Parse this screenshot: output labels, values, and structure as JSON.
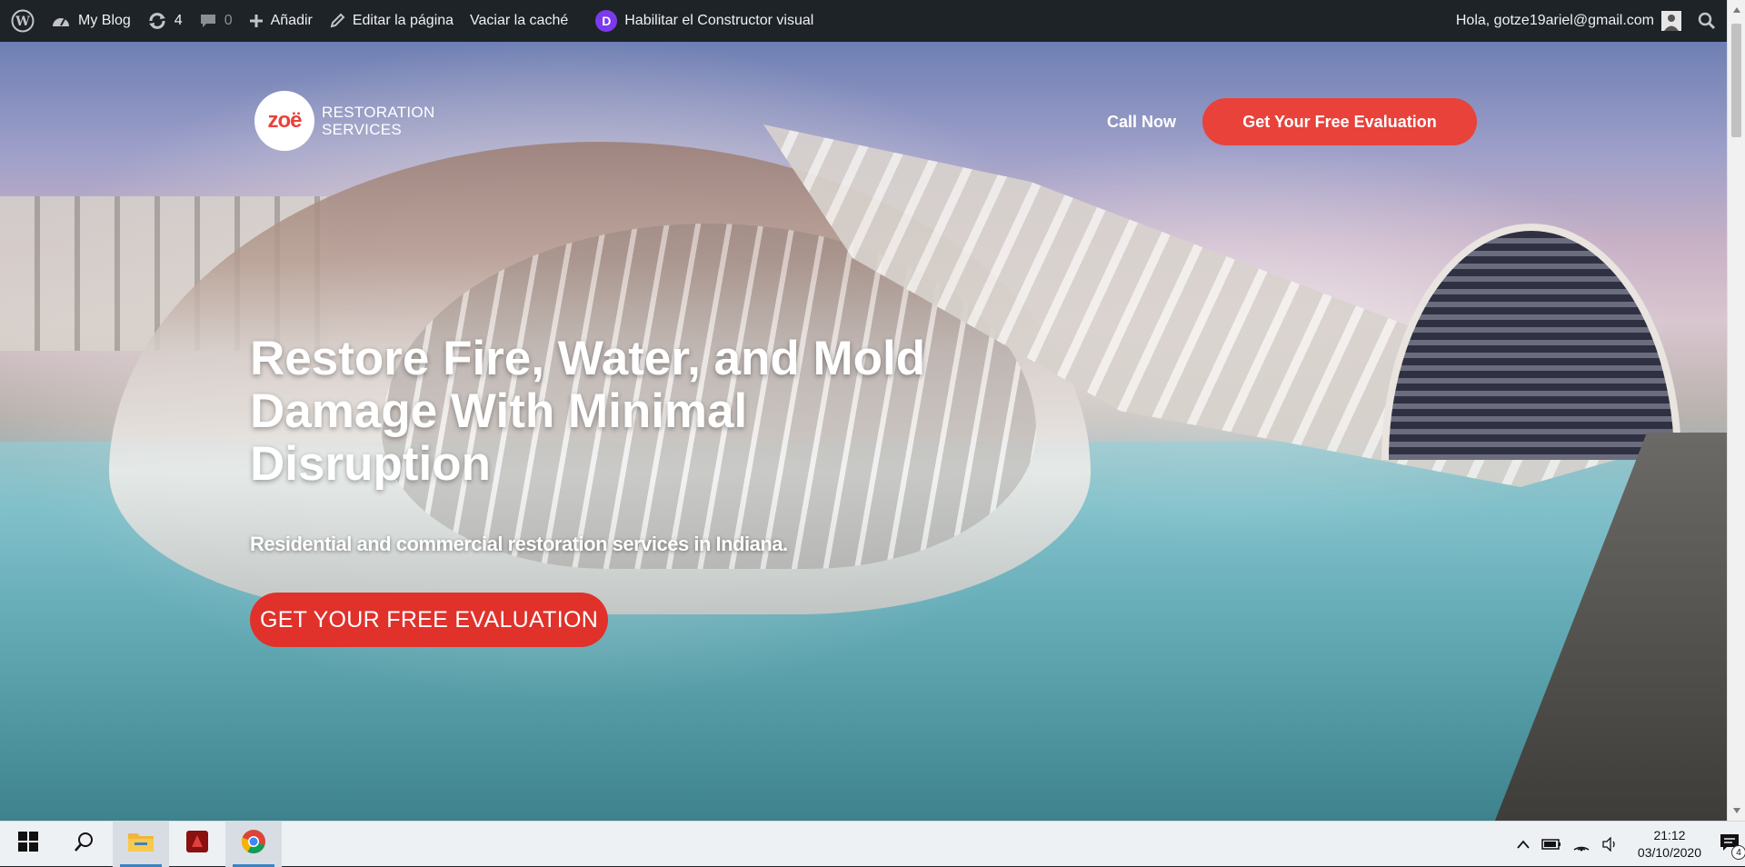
{
  "adminbar": {
    "site_name": "My Blog",
    "updates_count": "4",
    "comments_count": "0",
    "add_new_label": "Añadir",
    "edit_page_label": "Editar la página",
    "clear_cache_label": "Vaciar la caché",
    "divi_badge": "D",
    "visual_builder_label": "Habilitar el Constructor visual",
    "greeting": "Hola, gotze19ariel@gmail.com"
  },
  "header": {
    "logo_mark": "zoë",
    "logo_line1": "RESTORATION",
    "logo_line2": "SERVICES",
    "call_now": "Call Now",
    "cta_label": "Get Your Free Evaluation"
  },
  "hero": {
    "title": "Restore Fire, Water, and Mold Damage With Minimal Disruption",
    "subtitle": "Residential and commercial restoration services in Indiana.",
    "cta_label": "GET YOUR FREE EVALUATION"
  },
  "taskbar": {
    "time": "21:12",
    "date": "03/10/2020",
    "notification_count": "4"
  },
  "colors": {
    "accent": "#e8423b",
    "adminbar": "#1d2327",
    "divi": "#7c3aed"
  }
}
